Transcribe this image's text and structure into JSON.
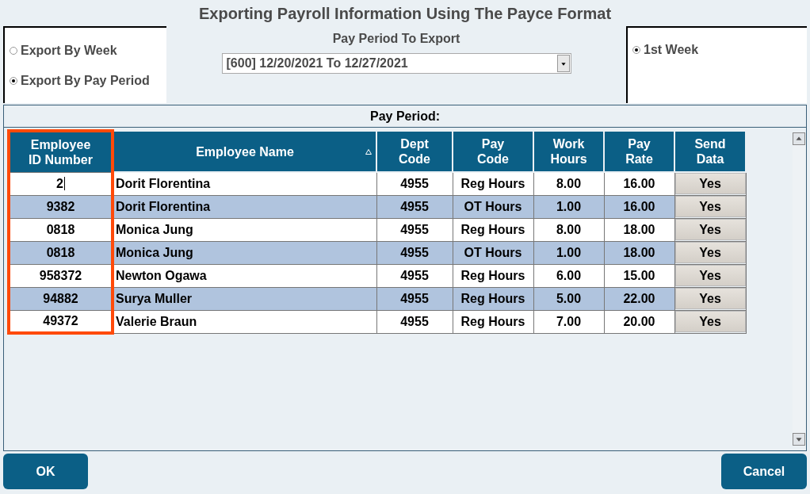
{
  "window": {
    "title": "Exporting Payroll Information Using The Payce Format"
  },
  "export_modes": [
    {
      "label": "Export By Week",
      "selected": false
    },
    {
      "label": "Export By Pay Period",
      "selected": true
    }
  ],
  "pay_period_select": {
    "label": "Pay Period To Export",
    "value": "[600] 12/20/2021 To 12/27/2021"
  },
  "weeks": [
    {
      "label": "1st Week",
      "selected": true
    }
  ],
  "grid": {
    "title": "Pay Period:",
    "columns": [
      {
        "label": "Employee ID Number",
        "highlighted": true,
        "sorted": false
      },
      {
        "label": "Employee Name",
        "highlighted": false,
        "sorted": true
      },
      {
        "label": "Dept Code",
        "highlighted": false,
        "sorted": false
      },
      {
        "label": "Pay Code",
        "highlighted": false,
        "sorted": false
      },
      {
        "label": "Work Hours",
        "highlighted": false,
        "sorted": false
      },
      {
        "label": "Pay Rate",
        "highlighted": false,
        "sorted": false
      },
      {
        "label": "Send Data",
        "highlighted": false,
        "sorted": false
      }
    ],
    "rows": [
      {
        "id": "2",
        "editing": true,
        "name": "Dorit Florentina",
        "dept": "4955",
        "pay_code": "Reg Hours",
        "hours": "8.00",
        "rate": "16.00",
        "send": "Yes"
      },
      {
        "id": "9382",
        "editing": false,
        "name": "Dorit Florentina",
        "dept": "4955",
        "pay_code": "OT Hours",
        "hours": "1.00",
        "rate": "16.00",
        "send": "Yes"
      },
      {
        "id": "0818",
        "editing": false,
        "name": "Monica Jung",
        "dept": "4955",
        "pay_code": "Reg Hours",
        "hours": "8.00",
        "rate": "18.00",
        "send": "Yes"
      },
      {
        "id": "0818",
        "editing": false,
        "name": "Monica Jung",
        "dept": "4955",
        "pay_code": "OT Hours",
        "hours": "1.00",
        "rate": "18.00",
        "send": "Yes"
      },
      {
        "id": "958372",
        "editing": false,
        "name": "Newton Ogawa",
        "dept": "4955",
        "pay_code": "Reg Hours",
        "hours": "6.00",
        "rate": "15.00",
        "send": "Yes"
      },
      {
        "id": "94882",
        "editing": false,
        "name": "Surya Muller",
        "dept": "4955",
        "pay_code": "Reg Hours",
        "hours": "5.00",
        "rate": "22.00",
        "send": "Yes"
      },
      {
        "id": "49372",
        "editing": false,
        "name": "Valerie Braun",
        "dept": "4955",
        "pay_code": "Reg Hours",
        "hours": "7.00",
        "rate": "20.00",
        "send": "Yes"
      }
    ]
  },
  "buttons": [
    {
      "label": "OK",
      "kind": "left"
    },
    {
      "label": "Cancel",
      "kind": "right"
    }
  ]
}
